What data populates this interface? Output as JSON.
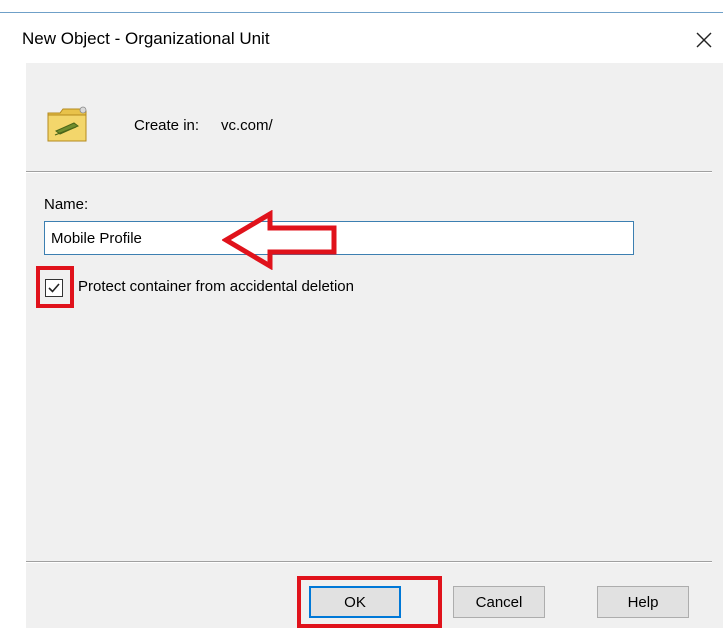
{
  "window": {
    "title": "New Object - Organizational Unit"
  },
  "header": {
    "create_in_label": "Create in:",
    "create_in_value": "vc.com/"
  },
  "form": {
    "name_label": "Name:",
    "name_value": "Mobile Profile",
    "protect_label": "Protect container from accidental deletion",
    "protect_checked": true
  },
  "buttons": {
    "ok": "OK",
    "cancel": "Cancel",
    "help": "Help"
  },
  "annotations": {
    "color": "#e0121b"
  },
  "colors": {
    "client_bg": "#f0f0f0",
    "focus_blue": "#0078d7"
  }
}
